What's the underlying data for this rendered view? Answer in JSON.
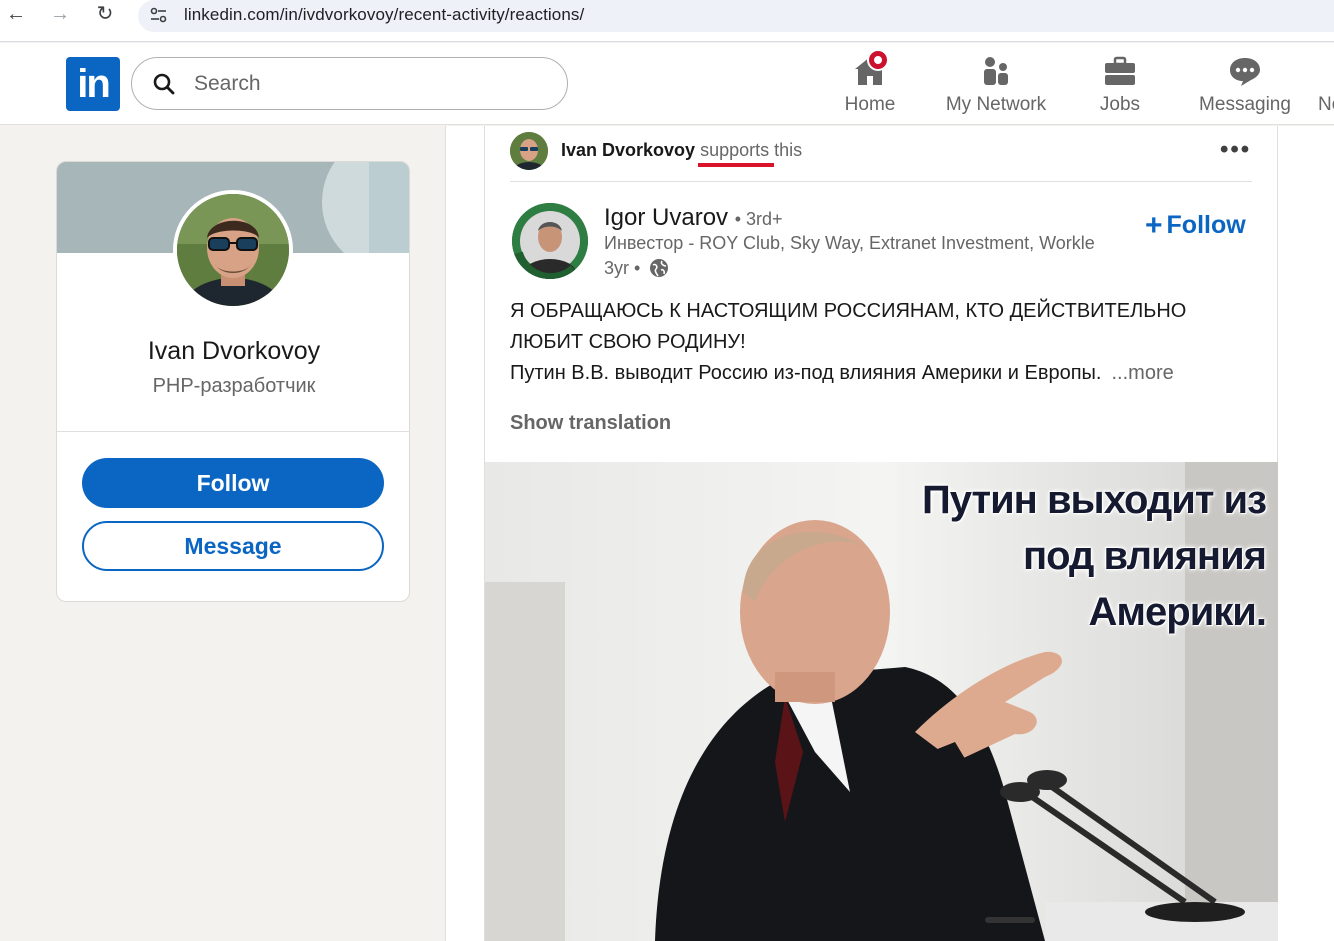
{
  "browser": {
    "url": "linkedin.com/in/ivdvorkovoy/recent-activity/reactions/"
  },
  "header": {
    "logo_text": "in",
    "search_placeholder": "Search",
    "nav": [
      {
        "label": "Home",
        "icon": "home-icon",
        "has_badge": true
      },
      {
        "label": "My Network",
        "icon": "network-icon"
      },
      {
        "label": "Jobs",
        "icon": "briefcase-icon"
      },
      {
        "label": "Messaging",
        "icon": "messaging-icon"
      },
      {
        "label": "No",
        "icon": "notifications-icon"
      }
    ]
  },
  "profile": {
    "name": "Ivan Dvorkovoy",
    "headline": "PHP-разработчик",
    "follow_label": "Follow",
    "message_label": "Message"
  },
  "post": {
    "activity": {
      "actor": "Ivan Dvorkovoy",
      "verb": "supports",
      "suffix": "this"
    },
    "author": {
      "name": "Igor Uvarov",
      "degree": "• 3rd+",
      "headline": "Инвестор - ROY Club, Sky Way, Extranet Investment, Workle",
      "meta": "3yr •",
      "follow_label": "Follow"
    },
    "body_line1": "Я ОБРАЩАЮСЬ К НАСТОЯЩИМ РОССИЯНАМ, КТО ДЕЙСТВИТЕЛЬНО",
    "body_line2": "ЛЮБИТ СВОЮ РОДИНУ!",
    "body_line3": "Путин В.В. выводит Россию из-под влияния Америки и Европы.",
    "more_label": "...more",
    "show_translation": "Show translation",
    "image_caption": [
      "Путин выходит из",
      "под влияния",
      "Америки."
    ]
  },
  "colors": {
    "brand": "#0a66c2",
    "badge": "#cb112d",
    "underline": "#d8132a"
  }
}
